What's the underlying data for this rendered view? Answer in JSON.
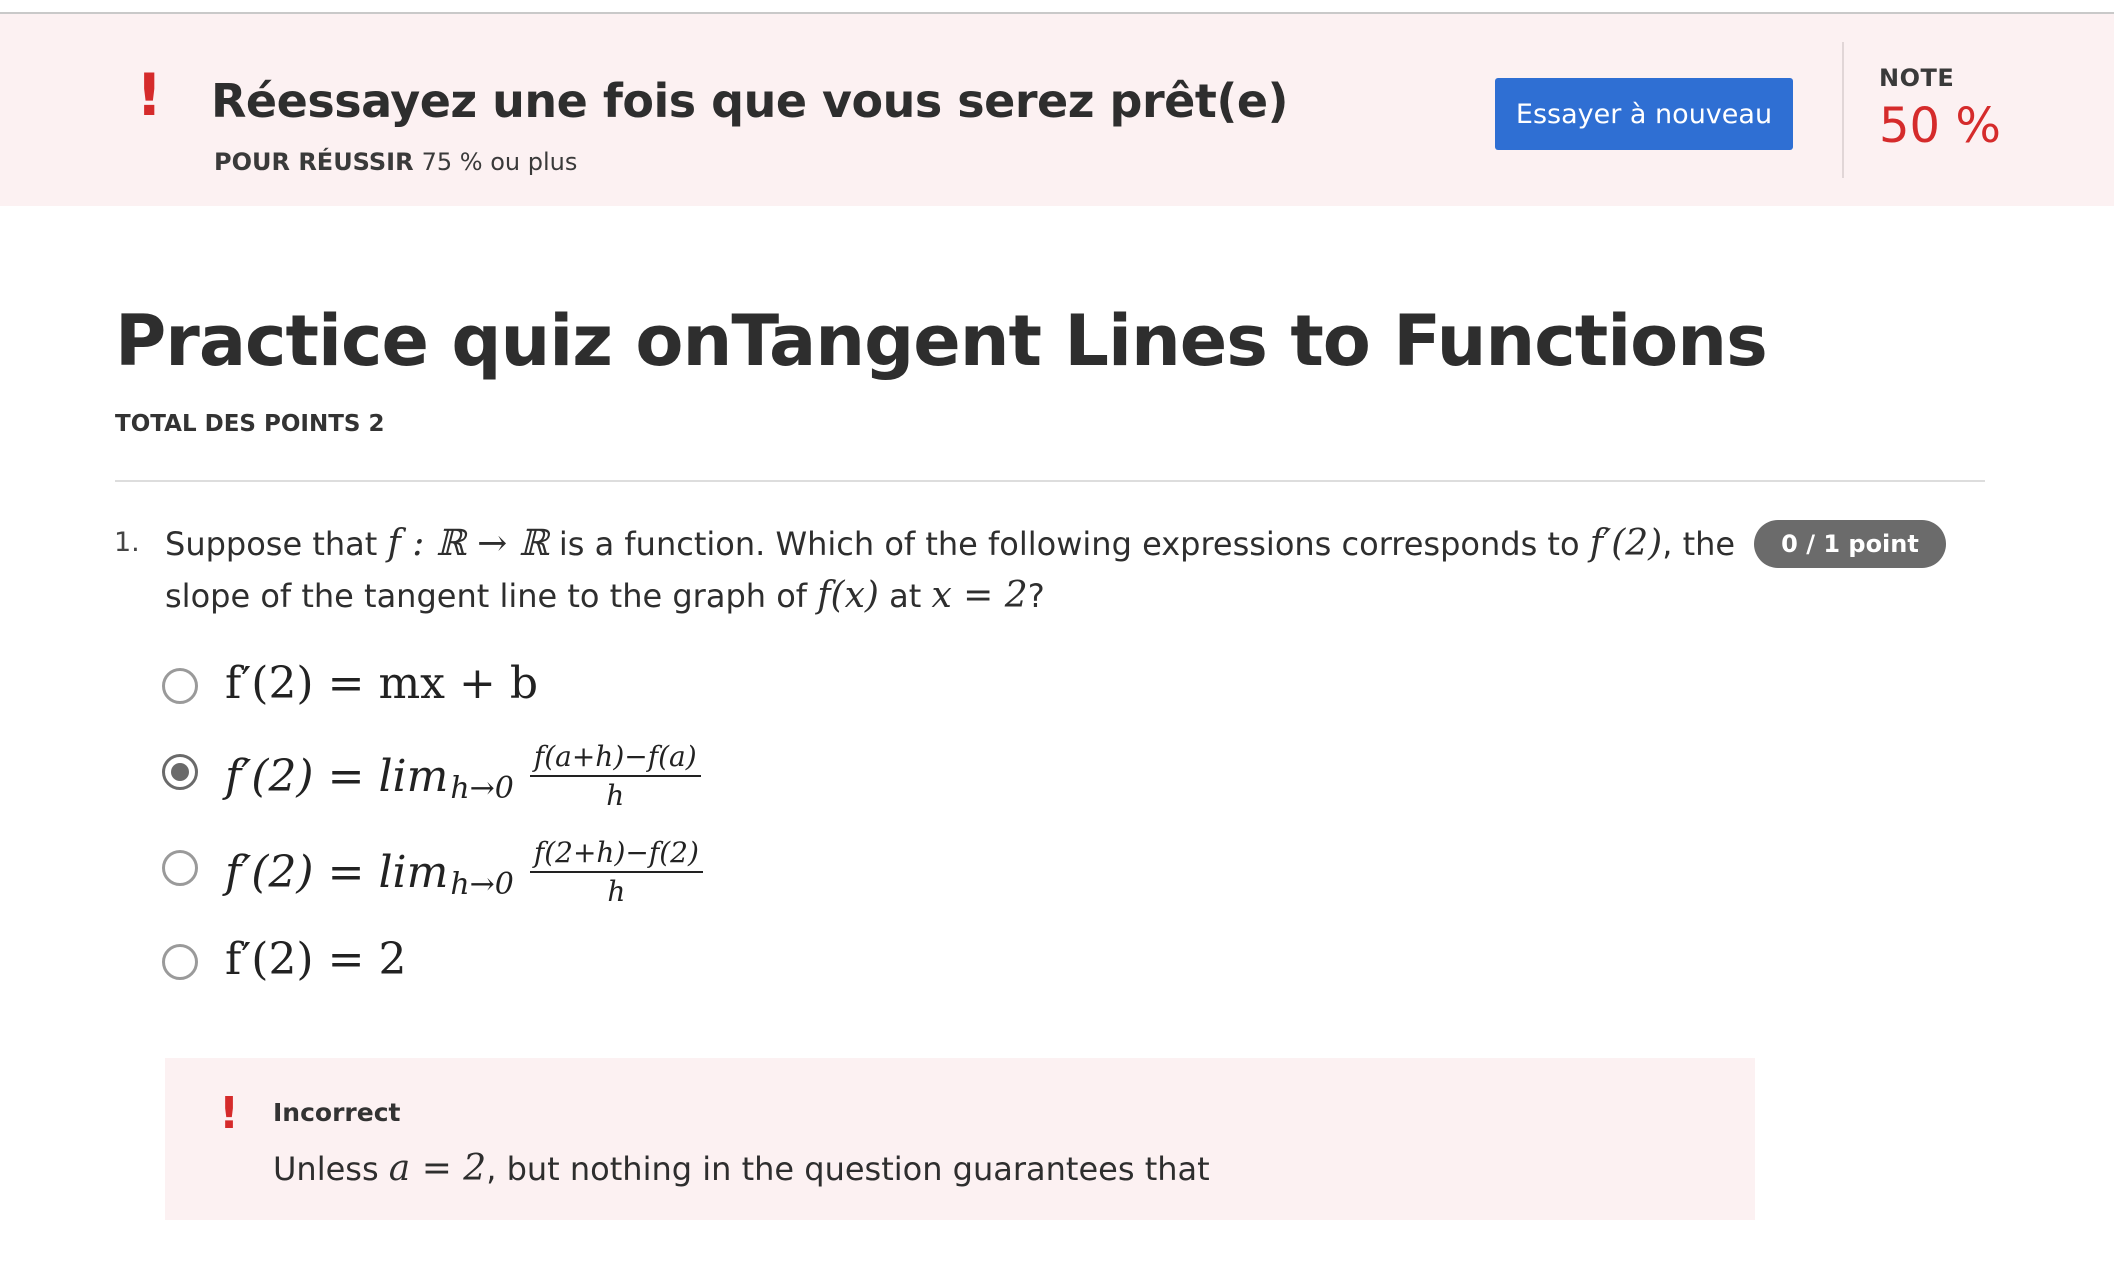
{
  "banner": {
    "headline": "Réessayez une fois que vous serez prêt(e)",
    "pass_label": "POUR RÉUSSIR",
    "pass_value": "75 % ou plus",
    "retry_button": "Essayer à nouveau",
    "grade_label": "NOTE",
    "grade_value": "50 %",
    "alert_icon": "exclamation-icon",
    "alert_color": "#d52b2b",
    "background_color": "#fcf1f2",
    "button_color": "#2f6fd3"
  },
  "quiz": {
    "title": "Practice quiz onTangent Lines to Functions",
    "total_points": "TOTAL DES POINTS 2"
  },
  "question": {
    "number": "1.",
    "text_part1": "Suppose that ",
    "math_f_map": "f : ℝ → ℝ",
    "text_part2": " is a function. Which of the following expressions corresponds to ",
    "math_fprime2": "f′(2)",
    "text_part3": ", the slope of the tangent line to the graph of ",
    "math_fx": "f(x)",
    "text_part4": " at ",
    "math_x2": "x = 2",
    "text_part5": "?",
    "score": "0 / 1 point",
    "score_color": "#6b6b6b",
    "options": [
      {
        "lhs": "f′(2) = mx + b",
        "selected": false
      },
      {
        "lhs": "f′(2) = lim",
        "sub": "h→0",
        "num": "f(a+h)−f(a)",
        "den": "h",
        "selected": true
      },
      {
        "lhs": "f′(2) = lim",
        "sub": "h→0",
        "num": "f(2+h)−f(2)",
        "den": "h",
        "selected": false
      },
      {
        "lhs": "f′(2) = 2",
        "selected": false
      }
    ]
  },
  "feedback": {
    "title": "Incorrect",
    "text_part1": "Unless ",
    "math": "a = 2",
    "text_part2": ", but nothing in the question guarantees that"
  }
}
